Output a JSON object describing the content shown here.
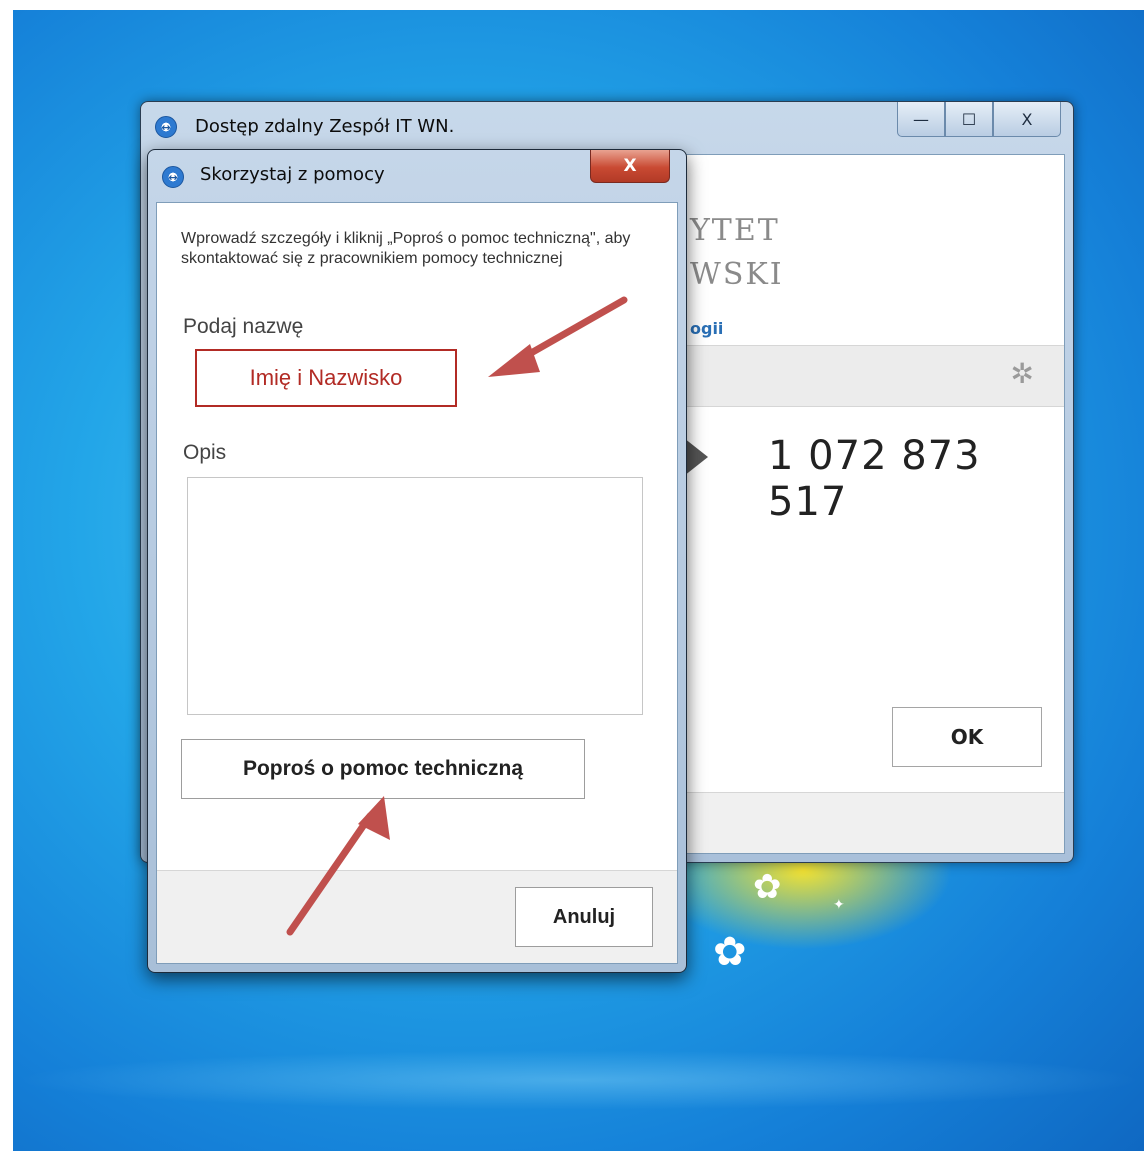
{
  "main_window": {
    "title": "Dostęp zdalny Zespół IT WN.",
    "caption_min": "—",
    "caption_max": "☐",
    "caption_close": "X",
    "uni_line1": "YTET",
    "uni_line2": "WSKI",
    "uni_link": "ogii",
    "partner_id": "1 072 873 517",
    "ok_label": "OK",
    "settings_icon": "gear-icon"
  },
  "dialog": {
    "title": "Skorzystaj z pomocy",
    "close_label": "X",
    "instructions": "Wprowadź szczegóły i kliknij „Poproś o pomoc techniczną\", aby skontaktować się z pracownikiem pomocy technicznej",
    "name_label": "Podaj nazwę",
    "name_value": "Imię i Nazwisko",
    "description_label": "Opis",
    "description_value": "",
    "help_button_label": "Poproś o pomoc techniczną",
    "cancel_label": "Anuluj"
  },
  "colors": {
    "annotation_red": "#b22b25",
    "arrow_fill": "#c0504d",
    "link_blue": "#2a6fb5"
  }
}
